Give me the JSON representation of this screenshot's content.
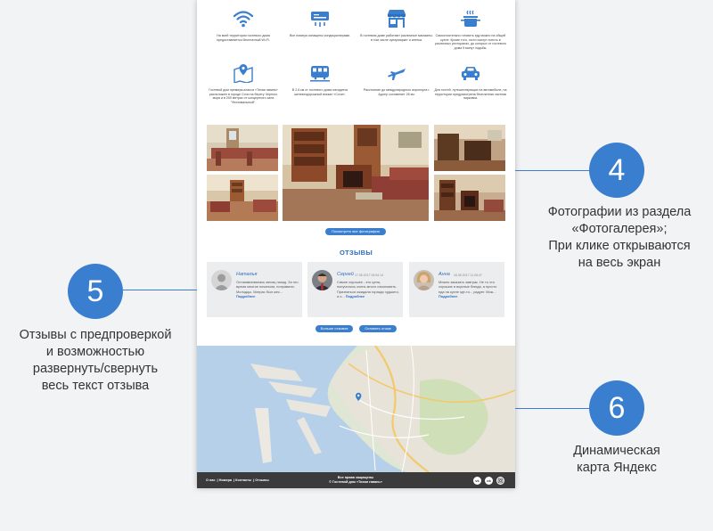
{
  "features": [
    {
      "icon": "wifi-icon",
      "text": "На всей территории гостевого дома предоставляется бесплатный Wi-Fi."
    },
    {
      "icon": "air-conditioner-icon",
      "text": "Все номера оснащены кондиционерами."
    },
    {
      "icon": "shop-icon",
      "text": "В гостевом доме работают различные магазины, в том числе супермаркет и аптека."
    },
    {
      "icon": "cooking-pot-icon",
      "text": "Самостоятельно готовить еду можно на общей кухне. Кроме того, гости смогут поесть в различных ресторанах, до которых от гостевого дома 5 минут ходьбы."
    },
    {
      "icon": "map-pin-icon",
      "text": "Гостевой дом премиум-класса «Тихая гавань» расположен в городе Сочи на берегу Черного моря и в 200 метрах от концертного зала \"Фестивальный\"."
    },
    {
      "icon": "train-icon",
      "text": "В 2,6 км от гостевого дома находится железнодорожный вокзал «Сочи»."
    },
    {
      "icon": "airplane-icon",
      "text": "Расстояние до международного аэропорта г. Адлер составляет 28 км."
    },
    {
      "icon": "car-icon",
      "text": "Для гостей, путешествующих на автомобиле, на территории предусмотрена бесплатная частная парковка."
    }
  ],
  "gallery": {
    "button_label": "Посмотреть все фотографии"
  },
  "reviews": {
    "title": "ОТЗЫВЫ",
    "items": [
      {
        "name": "Наталья",
        "date": "",
        "text": "Останавливалась месяц назад. За это время многое починили, поправили. Молодцы. Матрас был жес...",
        "more": "Подробнее"
      },
      {
        "name": "Сергей",
        "date": "17.05.2017 09:54:14",
        "text": "Самое хорошее - это цена, получилось очень много сэкономить. Признаться ожидала гораздо худшего, а о...",
        "more": "Подробнее"
      },
      {
        "name": "Анна",
        "date": "16.05.2017 11:26:47",
        "text": "Можно заказать завтрак. Не то что хорошие и вкусные блюда, а просто еда на кухне где-то... радует. Мож...",
        "more": "Подробнее"
      }
    ],
    "more_button": "Больше отзывов",
    "leave_button": "Оставить отзыв"
  },
  "footer": {
    "links": [
      "О нас",
      "Номера",
      "Контакты",
      "Отзывы"
    ],
    "copyright_line1": "Все права защищены",
    "copyright_line2": "© Гостевой дом «Тихая гавань»",
    "social": [
      "vk",
      "ok",
      "instagram"
    ]
  },
  "annotations": [
    {
      "number": "4",
      "caption_lines": [
        "Фотографии из раздела",
        "«Фотогалерея»;",
        "При клике открываются",
        "на весь экран"
      ]
    },
    {
      "number": "5",
      "caption_lines": [
        "Отзывы с предпроверкой",
        "и возможностью",
        "развернуть/свернуть",
        "весь текст отзыва"
      ]
    },
    {
      "number": "6",
      "caption_lines": [
        "Динамическая",
        "карта Яндекс"
      ]
    }
  ],
  "colors": {
    "accent": "#3a7ecf",
    "footer": "#3b3b3b",
    "card": "#ecedef",
    "background": "#f2f3f5"
  }
}
